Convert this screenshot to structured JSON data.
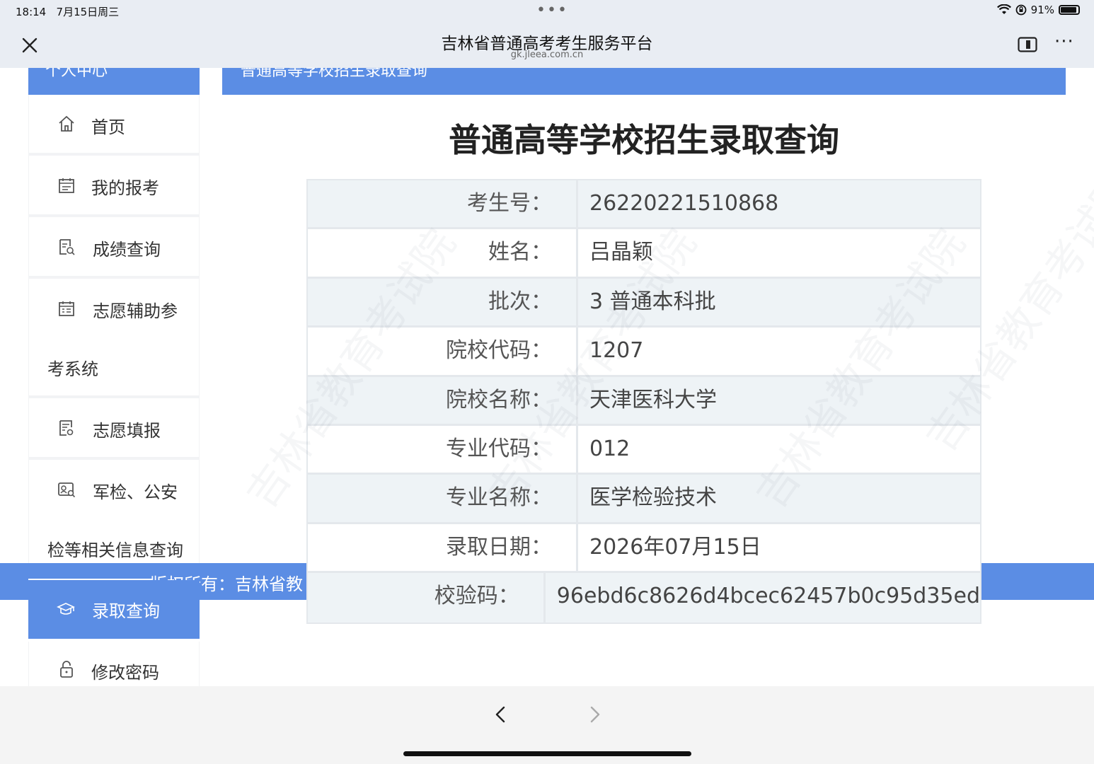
{
  "status_bar": {
    "time": "18:14",
    "date": "7月15日周三",
    "battery": "91%",
    "battery_level": 0.91
  },
  "browser": {
    "title": "吉林省普通高考考生服务平台",
    "url": "gk.jleea.com.cn"
  },
  "page": {
    "sidebar_header": "个人中心",
    "main_header": "普通高等学校招生录取查询",
    "title": "普通高等学校招生录取查询",
    "copyright": "版权所有：吉林省教"
  },
  "sidebar": {
    "items": [
      {
        "label": "首页",
        "icon": "home-icon"
      },
      {
        "label": "我的报考",
        "icon": "calendar-icon"
      },
      {
        "label": "成绩查询",
        "icon": "score-search-icon"
      },
      {
        "label": "志愿辅助参",
        "label_cont": "考系统",
        "icon": "calendar-list-icon"
      },
      {
        "label": "志愿填报",
        "icon": "form-icon"
      },
      {
        "label": "军检、公安",
        "label_cont": "检等相关信息查询",
        "icon": "id-search-icon"
      },
      {
        "label": "录取查询",
        "icon": "graduation-cap-icon",
        "active": true
      },
      {
        "label": "修改密码",
        "icon": "lock-icon"
      }
    ]
  },
  "result": {
    "rows": [
      {
        "label": "考生号：",
        "value": "26220221510868"
      },
      {
        "label": "姓名：",
        "value": "吕晶颖"
      },
      {
        "label": "批次：",
        "value": "3 普通本科批"
      },
      {
        "label": "院校代码：",
        "value": "1207"
      },
      {
        "label": "院校名称：",
        "value": "天津医科大学"
      },
      {
        "label": "专业代码：",
        "value": "012"
      },
      {
        "label": "专业名称：",
        "value": "医学检验技术"
      },
      {
        "label": "录取日期：",
        "value": "2026年07月15日"
      },
      {
        "label": "校验码：",
        "value": "96ebd6c8626d4bcec62457b0c95d35ed"
      }
    ]
  },
  "watermark_text": "吉林省教育考试院",
  "colors": {
    "accent": "#5b8de4",
    "row_shade": "#eef3f6",
    "border": "#e4e8ec",
    "chrome": "#e9edf3"
  }
}
